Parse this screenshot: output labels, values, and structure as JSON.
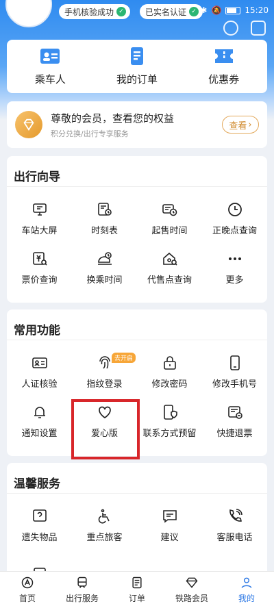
{
  "status_bar": {
    "pill1": "手机核验成功",
    "pill2": "已实名认证",
    "time": "15:20"
  },
  "quick_actions": [
    {
      "label": "乘车人",
      "icon": "passenger-card-icon"
    },
    {
      "label": "我的订单",
      "icon": "order-doc-icon"
    },
    {
      "label": "优惠券",
      "icon": "coupon-icon"
    }
  ],
  "member": {
    "title": "尊敬的会员，查看您的权益",
    "subtitle": "积分兑换/出行专享服务",
    "button": "查看"
  },
  "travel_guide": {
    "title": "出行向导",
    "items": [
      {
        "label": "车站大屏"
      },
      {
        "label": "时刻表"
      },
      {
        "label": "起售时间"
      },
      {
        "label": "正晚点查询"
      },
      {
        "label": "票价查询"
      },
      {
        "label": "换乘时间"
      },
      {
        "label": "代售点查询"
      },
      {
        "label": "更多"
      }
    ]
  },
  "common_functions": {
    "title": "常用功能",
    "badge": "去开启",
    "items": [
      {
        "label": "人证核验"
      },
      {
        "label": "指纹登录"
      },
      {
        "label": "修改密码"
      },
      {
        "label": "修改手机号"
      },
      {
        "label": "通知设置"
      },
      {
        "label": "爱心版"
      },
      {
        "label": "联系方式预留"
      },
      {
        "label": "快捷退票"
      }
    ]
  },
  "warm_service": {
    "title": "温馨服务",
    "items": [
      {
        "label": "遗失物品"
      },
      {
        "label": "重点旅客"
      },
      {
        "label": "建议"
      },
      {
        "label": "客服电话"
      }
    ]
  },
  "tabs": [
    {
      "label": "首页"
    },
    {
      "label": "出行服务"
    },
    {
      "label": "订单"
    },
    {
      "label": "铁路会员"
    },
    {
      "label": "我的"
    }
  ],
  "colors": {
    "accent": "#2f7ae5",
    "header_blue": "#2f8bf0",
    "highlight_red": "#d8262a",
    "badge_orange": "#f7a638"
  }
}
